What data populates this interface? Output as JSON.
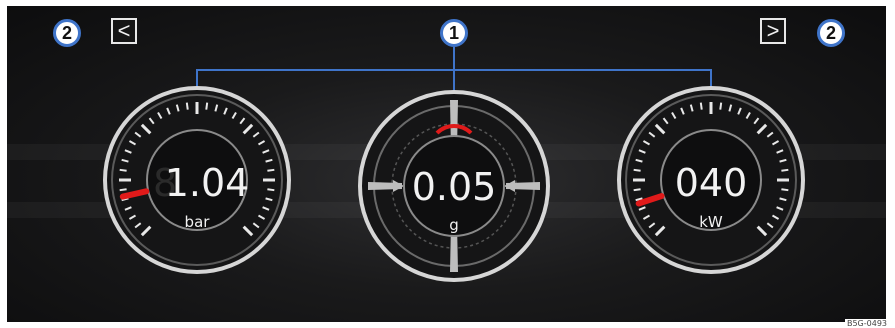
{
  "callouts": {
    "gauges": "1",
    "nav_left": "2",
    "nav_right": "2"
  },
  "nav": {
    "prev_symbol": "<",
    "next_symbol": ">"
  },
  "gauges": [
    {
      "id": "boost",
      "value": "1.04",
      "unit": "bar",
      "needle_level": 0.12
    },
    {
      "id": "gforce",
      "value": "0.05",
      "unit": "g"
    },
    {
      "id": "power",
      "value": "040",
      "unit": "kW",
      "needle_level": 0.1
    }
  ],
  "image_ref": "B5G-0493",
  "colors": {
    "callout_blue": "#3f74c9",
    "needle_red": "#e01a1a",
    "screen_bg": "#1a1a1b",
    "digit": "#f2f2f2"
  }
}
